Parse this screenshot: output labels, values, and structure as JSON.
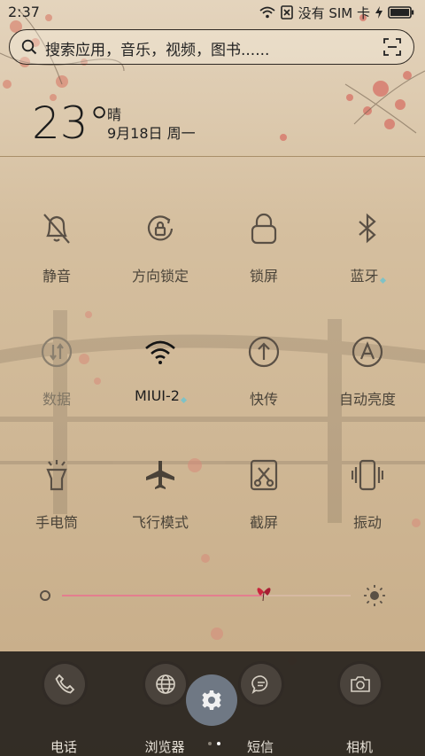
{
  "status_bar": {
    "time": "2:37",
    "carrier": "没有 SIM 卡"
  },
  "search": {
    "placeholder": "搜索应用，音乐，视频，图书......"
  },
  "weather": {
    "temperature": "23°",
    "condition": "晴",
    "date": "9月18日 周一"
  },
  "toggles": [
    {
      "label": "静音",
      "icon": "mute-icon",
      "state": "off"
    },
    {
      "label": "方向锁定",
      "icon": "rotation-lock-icon",
      "state": "off"
    },
    {
      "label": "锁屏",
      "icon": "lock-icon",
      "state": "off"
    },
    {
      "label": "蓝牙",
      "icon": "bluetooth-icon",
      "state": "off"
    },
    {
      "label": "数据",
      "icon": "data-icon",
      "state": "disabled"
    },
    {
      "label": "MIUI-2",
      "icon": "wifi-icon",
      "state": "on"
    },
    {
      "label": "快传",
      "icon": "share-icon",
      "state": "off"
    },
    {
      "label": "自动亮度",
      "icon": "auto-brightness-icon",
      "state": "off"
    },
    {
      "label": "手电筒",
      "icon": "flashlight-icon",
      "state": "off"
    },
    {
      "label": "飞行模式",
      "icon": "airplane-icon",
      "state": "off"
    },
    {
      "label": "截屏",
      "icon": "screenshot-icon",
      "state": "off"
    },
    {
      "label": "振动",
      "icon": "vibrate-icon",
      "state": "off"
    }
  ],
  "brightness": {
    "level": 0.7
  },
  "dock": [
    {
      "label": "电话",
      "icon": "phone-icon"
    },
    {
      "label": "浏览器",
      "icon": "browser-icon"
    },
    {
      "label": "短信",
      "icon": "message-icon"
    },
    {
      "label": "相机",
      "icon": "camera-icon"
    }
  ],
  "settings_button": {
    "icon": "gear-icon"
  },
  "pager": {
    "pages": 2,
    "current": 2
  },
  "colors": {
    "paper": "#cdb592",
    "accent_pink": "#e47e8f",
    "dock": "#28231e"
  }
}
